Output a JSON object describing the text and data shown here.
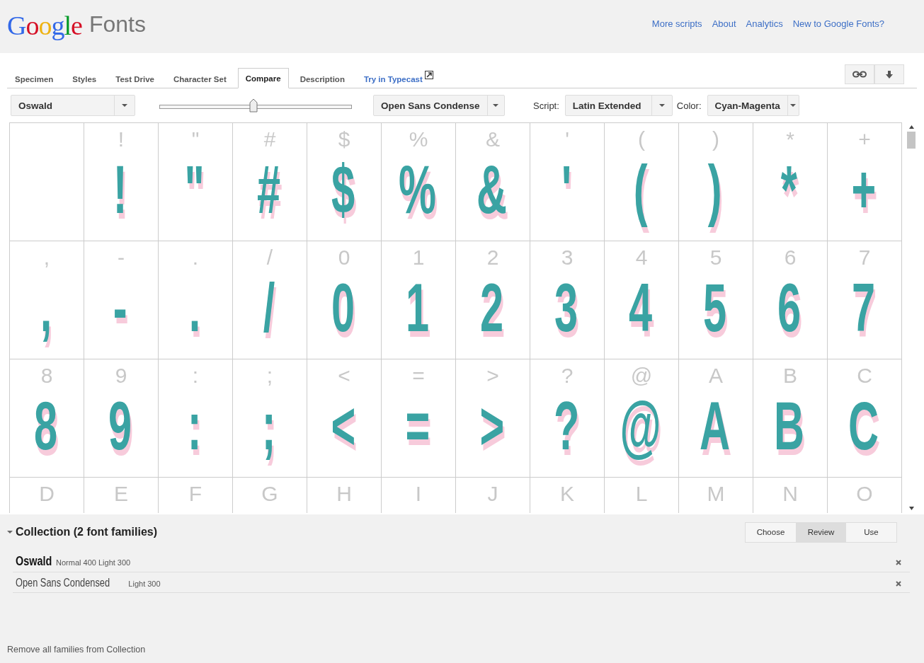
{
  "header": {
    "logo": "Google",
    "product": "Fonts",
    "links": [
      "More scripts",
      "About",
      "Analytics",
      "New to Google Fonts?"
    ]
  },
  "tabs": [
    {
      "label": "Specimen",
      "selected": false,
      "kind": "tab"
    },
    {
      "label": "Styles",
      "selected": false,
      "kind": "tab"
    },
    {
      "label": "Test Drive",
      "selected": false,
      "kind": "tab"
    },
    {
      "label": "Character Set",
      "selected": false,
      "kind": "tab"
    },
    {
      "label": "Compare",
      "selected": true,
      "kind": "tab"
    },
    {
      "label": "Description",
      "selected": false,
      "kind": "tab"
    },
    {
      "label": "Try in Typecast",
      "selected": false,
      "kind": "external"
    }
  ],
  "controls": {
    "font_a": "Oswald",
    "slider": {
      "level": 0.49
    },
    "font_b": "Open Sans Condense",
    "script_label": "Script:",
    "script": "Latin Extended",
    "color_label": "Color:",
    "color_scheme": "Cyan-Magenta"
  },
  "grid": [
    [
      {
        "kind": "empty"
      },
      {
        "kind": "glyph",
        "char": "!",
        "glyph": "!"
      },
      {
        "kind": "glyph",
        "char": "\"",
        "glyph": "\""
      },
      {
        "kind": "glyph",
        "char": "#",
        "glyph": "#"
      },
      {
        "kind": "glyph",
        "char": "$",
        "glyph": "$"
      },
      {
        "kind": "glyph",
        "char": "%",
        "glyph": "%"
      },
      {
        "kind": "glyph",
        "char": "&",
        "glyph": "&"
      },
      {
        "kind": "glyph",
        "char": "'",
        "glyph": "'"
      },
      {
        "kind": "glyph",
        "char": "(",
        "glyph": "("
      },
      {
        "kind": "glyph",
        "char": ")",
        "glyph": ")"
      },
      {
        "kind": "glyph",
        "char": "*",
        "glyph": "*"
      },
      {
        "kind": "glyph",
        "char": "+",
        "glyph": "+"
      }
    ],
    [
      {
        "kind": "glyph",
        "char": ",",
        "glyph": ","
      },
      {
        "kind": "glyph",
        "char": "-",
        "glyph": "-"
      },
      {
        "kind": "glyph",
        "char": ".",
        "glyph": "."
      },
      {
        "kind": "glyph",
        "char": "/",
        "glyph": "/"
      },
      {
        "kind": "glyph",
        "char": "0",
        "glyph": "0"
      },
      {
        "kind": "glyph",
        "char": "1",
        "glyph": "1"
      },
      {
        "kind": "glyph",
        "char": "2",
        "glyph": "2"
      },
      {
        "kind": "glyph",
        "char": "3",
        "glyph": "3"
      },
      {
        "kind": "glyph",
        "char": "4",
        "glyph": "4"
      },
      {
        "kind": "glyph",
        "char": "5",
        "glyph": "5"
      },
      {
        "kind": "glyph",
        "char": "6",
        "glyph": "6"
      },
      {
        "kind": "glyph",
        "char": "7",
        "glyph": "7"
      }
    ],
    [
      {
        "kind": "glyph",
        "char": "8",
        "glyph": "8"
      },
      {
        "kind": "glyph",
        "char": "9",
        "glyph": "9"
      },
      {
        "kind": "glyph",
        "char": ":",
        "glyph": ":"
      },
      {
        "kind": "glyph",
        "char": ";",
        "glyph": ";"
      },
      {
        "kind": "glyph",
        "char": "<",
        "glyph": "<"
      },
      {
        "kind": "glyph",
        "char": "=",
        "glyph": "="
      },
      {
        "kind": "glyph",
        "char": ">",
        "glyph": ">"
      },
      {
        "kind": "glyph",
        "char": "?",
        "glyph": "?"
      },
      {
        "kind": "glyph",
        "char": "@",
        "glyph": "@"
      },
      {
        "kind": "glyph",
        "char": "A",
        "glyph": "A"
      },
      {
        "kind": "glyph",
        "char": "B",
        "glyph": "B"
      },
      {
        "kind": "glyph",
        "char": "C",
        "glyph": "C"
      }
    ],
    [
      {
        "kind": "glyph",
        "char": "D"
      },
      {
        "kind": "glyph",
        "char": "E"
      },
      {
        "kind": "glyph",
        "char": "F"
      },
      {
        "kind": "glyph",
        "char": "G"
      },
      {
        "kind": "glyph",
        "char": "H"
      },
      {
        "kind": "glyph",
        "char": "I"
      },
      {
        "kind": "glyph",
        "char": "J"
      },
      {
        "kind": "glyph",
        "char": "K"
      },
      {
        "kind": "glyph",
        "char": "L"
      },
      {
        "kind": "glyph",
        "char": "M"
      },
      {
        "kind": "glyph",
        "char": "N"
      },
      {
        "kind": "glyph",
        "char": "O"
      }
    ]
  ],
  "collection": {
    "title": "Collection (2 font families)",
    "expanded": true,
    "steps": [
      {
        "label": "Choose",
        "selected": false
      },
      {
        "label": "Review",
        "selected": true
      },
      {
        "label": "Use",
        "selected": false
      }
    ],
    "families": [
      {
        "name": "Oswald",
        "styles": "Normal 400  Light 300",
        "bold": true
      },
      {
        "name": "Open Sans Condensed",
        "styles": "Light 300",
        "bold": false
      }
    ],
    "remove_all": "Remove all families from Collection"
  }
}
